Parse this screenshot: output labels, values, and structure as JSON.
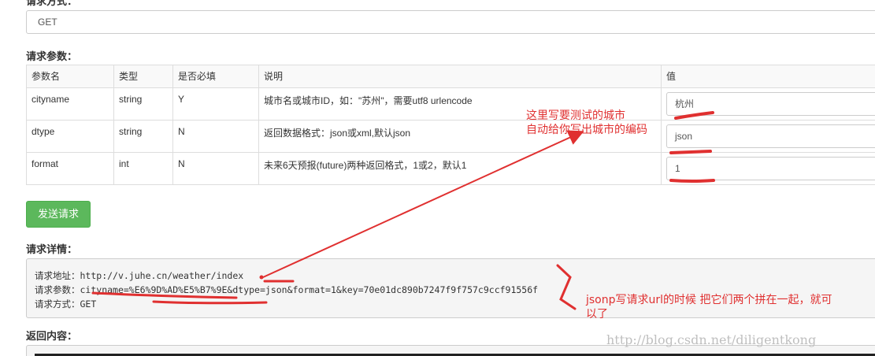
{
  "method_section": {
    "label": "请求方式：",
    "value": "GET"
  },
  "params_section": {
    "title": "请求参数：",
    "headers": [
      "参数名",
      "类型",
      "是否必填",
      "说明",
      "值"
    ],
    "rows": [
      {
        "name": "cityname",
        "type": "string",
        "required": "Y",
        "desc": "城市名或城市ID，如：\"苏州\"，需要utf8 urlencode",
        "value": "杭州"
      },
      {
        "name": "dtype",
        "type": "string",
        "required": "N",
        "desc": "返回数据格式：json或xml,默认json",
        "value": "json"
      },
      {
        "name": "format",
        "type": "int",
        "required": "N",
        "desc": "未来6天预报(future)两种返回格式，1或2，默认1",
        "value": "1"
      }
    ]
  },
  "send_button": {
    "label": "发送请求"
  },
  "detail_section": {
    "title": "请求详情：",
    "url_label": "请求地址：",
    "url": "http://v.juhe.cn/weather/index",
    "params_label": "请求参数：",
    "params": "cityname=%E6%9D%AD%E5%B7%9E&dtype=json&format=1&key=70e01dc890b7247f9f757c9ccf91556f",
    "method_label": "请求方式：",
    "method": "GET"
  },
  "return_section": {
    "title": "返回内容："
  },
  "annotations": {
    "note1_line1": "这里写要测试的城市",
    "note1_line2": "自动给你写出城市的编码",
    "note2_line1": "jsonp写请求url的时候 把它们两个拼在一起，就可",
    "note2_line2": "以了"
  },
  "watermark": "http://blog.csdn.net/diligentkong",
  "colors": {
    "annotation_red": "#e03030",
    "button_green": "#5cb85c"
  }
}
